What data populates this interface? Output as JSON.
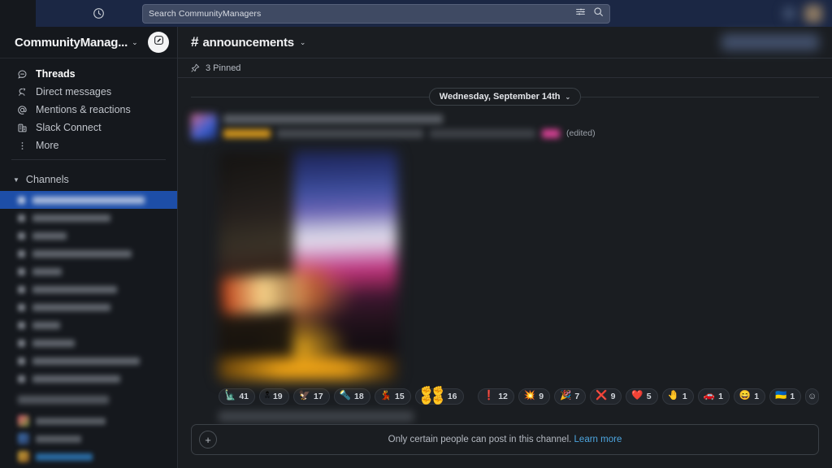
{
  "topbar": {
    "history_icon": "clock-history-icon",
    "search": {
      "placeholder": "Search CommunityManagers",
      "value": "",
      "filter_icon": "filter-sliders-icon",
      "search_icon": "magnifier-icon"
    },
    "help_icon": "help-icon",
    "avatar": "user-avatar"
  },
  "sidebar": {
    "workspace": {
      "name": "CommunityManag...",
      "chevron": "⌄",
      "compose_icon": "compose-pencil-icon"
    },
    "nav": [
      {
        "label": "Threads",
        "icon": "threads-icon",
        "active": true
      },
      {
        "label": "Direct messages",
        "icon": "direct-messages-icon",
        "active": false
      },
      {
        "label": "Mentions & reactions",
        "icon": "at-mention-icon",
        "active": false
      },
      {
        "label": "Slack Connect",
        "icon": "slack-connect-icon",
        "active": false
      },
      {
        "label": "More",
        "icon": "more-kebab-icon",
        "active": false
      }
    ],
    "channels_section": {
      "label": "Channels",
      "caret": "▼",
      "items": [
        {
          "redacted": true,
          "width": 138,
          "selected": true
        },
        {
          "redacted": true,
          "width": 96,
          "selected": false
        },
        {
          "redacted": true,
          "width": 42,
          "selected": false
        },
        {
          "redacted": true,
          "width": 122,
          "selected": false
        },
        {
          "redacted": true,
          "width": 36,
          "selected": false
        },
        {
          "redacted": true,
          "width": 104,
          "selected": false
        },
        {
          "redacted": true,
          "width": 96,
          "selected": false
        },
        {
          "redacted": true,
          "width": 34,
          "selected": false
        },
        {
          "redacted": true,
          "width": 52,
          "selected": false
        },
        {
          "redacted": true,
          "width": 132,
          "selected": false
        },
        {
          "redacted": true,
          "width": 108,
          "selected": false
        }
      ]
    },
    "dms_section": {
      "redacted_header": true,
      "items": [
        {
          "redacted": true,
          "width": 86
        },
        {
          "redacted": true,
          "width": 56
        },
        {
          "redacted": true,
          "width": 70
        }
      ]
    }
  },
  "channel": {
    "hash": "#",
    "name": "announcements",
    "chevron": "⌄",
    "pinned": {
      "icon": "pin-icon",
      "label": "3 Pinned"
    }
  },
  "conversation": {
    "date_divider": {
      "label": "Wednesday, September 14th",
      "chevron": "⌄"
    },
    "message": {
      "author_redacted": true,
      "edited_label": "(edited)",
      "attachment": {
        "name": "image-attachment",
        "redacted": true
      },
      "reactions": [
        {
          "emoji": "🗽",
          "name": "statue-of-liberty-custom-emoji",
          "count": "41"
        },
        {
          "emoji": "🕱",
          "name": "custom-emoji-2",
          "count": "19"
        },
        {
          "emoji": "🦅",
          "name": "custom-emoji-3",
          "count": "17"
        },
        {
          "emoji": "🔦",
          "name": "custom-emoji-4",
          "count": "18"
        },
        {
          "emoji": "💃",
          "name": "custom-emoji-5",
          "count": "15"
        },
        {
          "emoji": "✊✊✊✊",
          "name": "raised-fist-skintones-emoji",
          "count": "16"
        },
        {
          "emoji": "❗",
          "name": "exclamation-emoji",
          "count": "12",
          "group_break": true
        },
        {
          "emoji": "💥",
          "name": "collision-emoji",
          "count": "9"
        },
        {
          "emoji": "🎉",
          "name": "party-popper-emoji",
          "count": "7"
        },
        {
          "emoji": "❌",
          "name": "cross-mark-emoji",
          "count": "9"
        },
        {
          "emoji": "❤️",
          "name": "red-heart-emoji",
          "count": "5"
        },
        {
          "emoji": "🤚",
          "name": "raised-back-of-hand-emoji",
          "count": "1"
        },
        {
          "emoji": "🚗",
          "name": "car-emoji",
          "count": "1"
        },
        {
          "emoji": "😄",
          "name": "grinning-face-emoji",
          "count": "1"
        },
        {
          "emoji": "🇺🇦",
          "name": "ukraine-flag-emoji",
          "count": "1"
        }
      ],
      "add_reaction": {
        "icon": "add-reaction-icon",
        "glyph": "☺"
      }
    }
  },
  "composer": {
    "plus_icon": "plus-icon",
    "plus_glyph": "+",
    "notice": "Only certain people can post in this channel.",
    "learn_more": "Learn more"
  }
}
